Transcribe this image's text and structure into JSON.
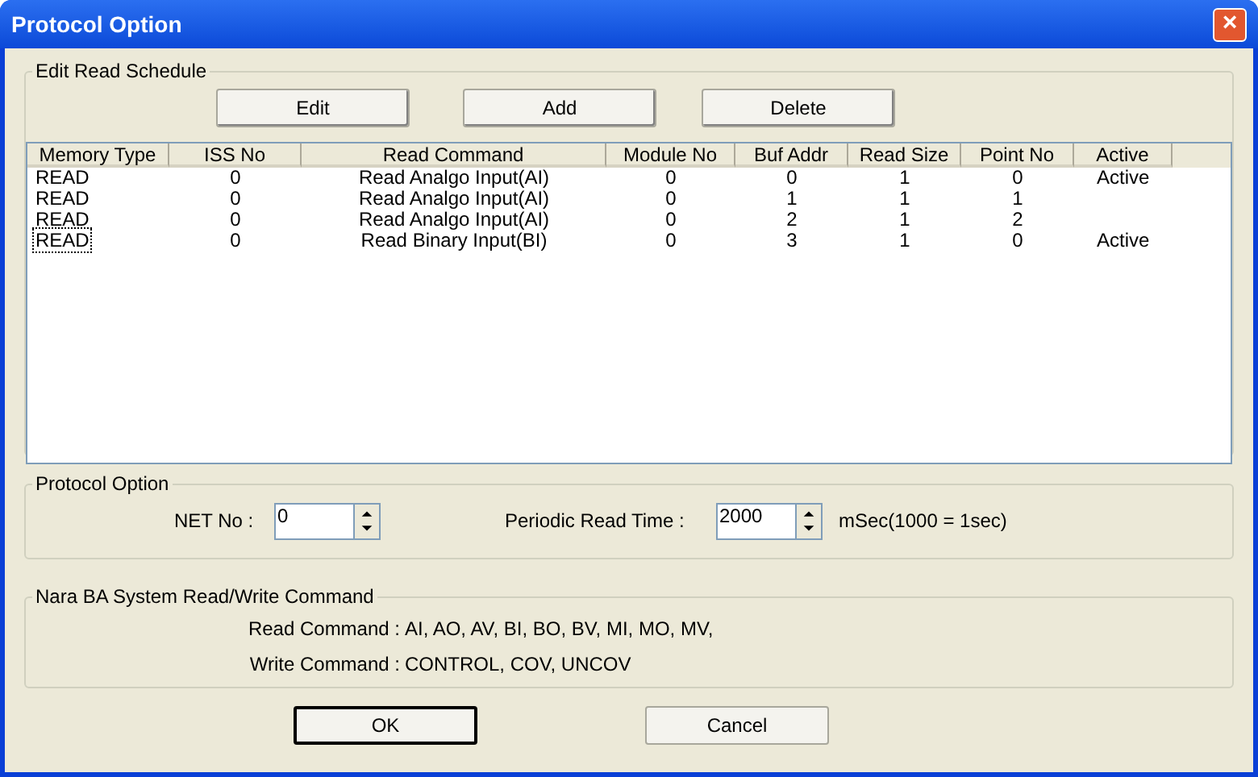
{
  "window": {
    "title": "Protocol Option",
    "close": "×"
  },
  "schedule": {
    "title": "Edit Read Schedule",
    "buttons": [
      "Edit",
      "Add",
      "Delete"
    ],
    "columns": [
      "Memory Type",
      "ISS No",
      "Read Command",
      "Module No",
      "Buf Addr",
      "Read Size",
      "Point No",
      "Active"
    ],
    "rows": [
      {
        "cells": [
          "READ",
          "0",
          "Read Analgo Input(AI)",
          "0",
          "0",
          "1",
          "0",
          "Active"
        ],
        "focused": false
      },
      {
        "cells": [
          "READ",
          "0",
          "Read Analgo Input(AI)",
          "0",
          "1",
          "1",
          "1",
          ""
        ],
        "focused": false
      },
      {
        "cells": [
          "READ",
          "0",
          "Read Analgo Input(AI)",
          "0",
          "2",
          "1",
          "2",
          ""
        ],
        "focused": false
      },
      {
        "cells": [
          "READ",
          "0",
          "Read Binary Input(BI)",
          "0",
          "3",
          "1",
          "0",
          "Active"
        ],
        "focused": true
      }
    ]
  },
  "protocol": {
    "title": "Protocol Option",
    "net_label": "NET No :",
    "net_value": "0",
    "period_label": "Periodic Read Time :",
    "period_value": "2000",
    "unit": "mSec(1000 = 1sec)"
  },
  "commands": {
    "title": "Nara BA System Read/Write Command",
    "lines": [
      {
        "label": "Read Command :",
        "value": "AI, AO, AV, BI, BO, BV, MI, MO, MV,"
      },
      {
        "label": "Write Command :",
        "value": "CONTROL, COV, UNCOV"
      }
    ]
  },
  "buttons": [
    {
      "label": "OK",
      "default": true
    },
    {
      "label": "Cancel",
      "default": false
    }
  ]
}
